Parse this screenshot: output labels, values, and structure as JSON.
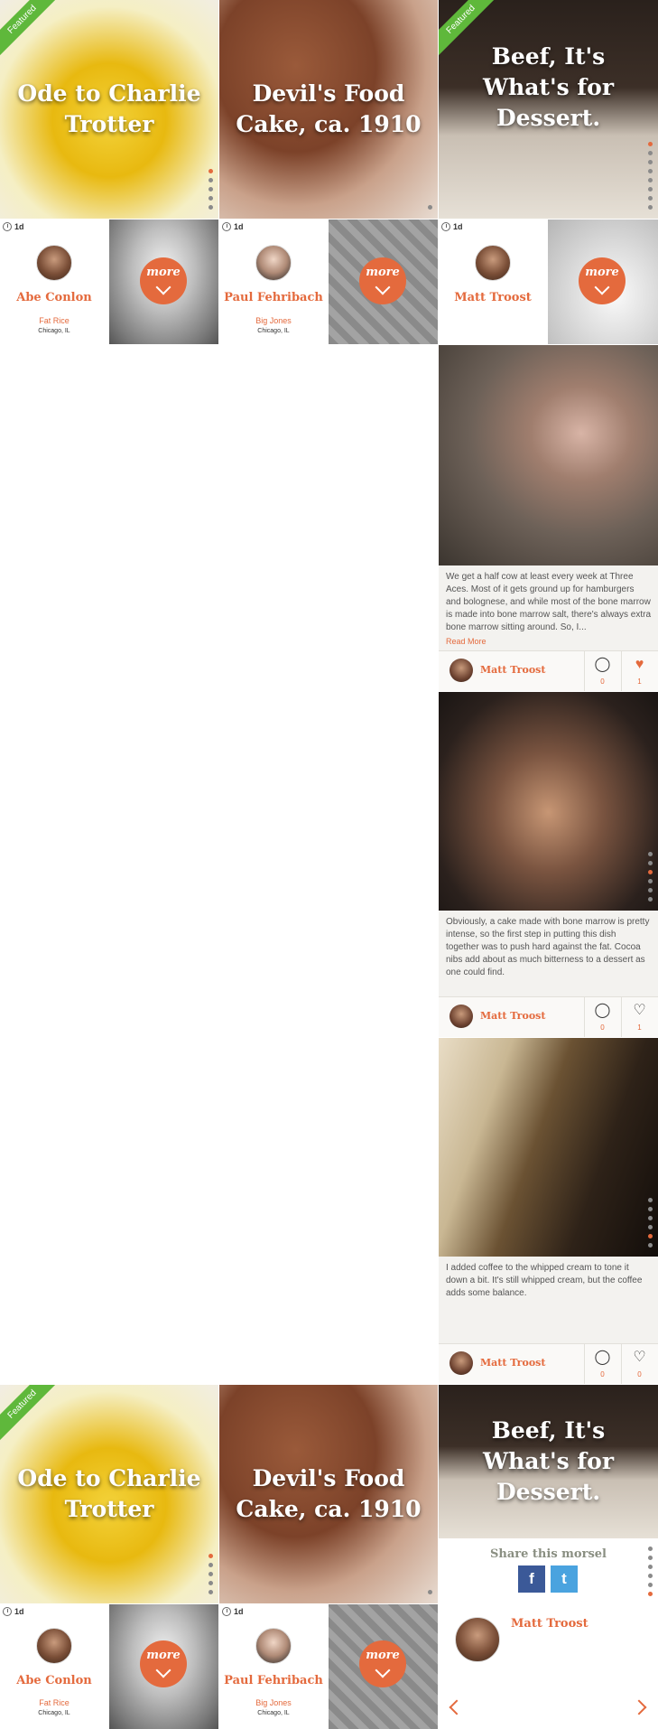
{
  "colors": {
    "accent": "#e46a3d",
    "featured": "#5fb83b",
    "facebook": "#3b5998",
    "twitter": "#4aa3df"
  },
  "featured_label": "Featured",
  "heroes": [
    {
      "title": "Ode to Charlie Trotter"
    },
    {
      "title": "Devil's Food Cake, ca. 1910"
    },
    {
      "title": "Beef, It's What's for Dessert."
    }
  ],
  "chefs": [
    {
      "time": "1d",
      "name": "Abe Conlon",
      "restaurant": "Fat Rice",
      "location": "Chicago, IL",
      "more_label": "more"
    },
    {
      "time": "1d",
      "name": "Paul Fehribach",
      "restaurant": "Big Jones",
      "location": "Chicago, IL",
      "more_label": "more"
    },
    {
      "time": "1d",
      "name": "Matt Troost",
      "restaurant": "",
      "location": "",
      "more_label": "more"
    }
  ],
  "posts": [
    {
      "text": "We get a half cow at least every week at Three Aces. Most of it gets ground up for hamburgers and bolognese, and while most of the bone marrow is made into bone marrow salt, there's always extra bone marrow sitting around. So, I...",
      "read_more": "Read More",
      "author": "Matt Troost",
      "comments": "0",
      "likes": "1"
    },
    {
      "text": "Obviously, a cake made with bone marrow is pretty intense, so the first step in putting this dish together was to push hard against the fat. Cocoa nibs add about as much bitterness to a dessert as one could find.",
      "author": "Matt Troost",
      "comments": "0",
      "likes": "1"
    },
    {
      "text": "I added coffee to the whipped cream to tone it down a bit. It's still whipped cream, but the coffee adds some balance.",
      "author": "Matt Troost",
      "comments": "0",
      "likes": "0"
    }
  ],
  "share": {
    "title": "Share this morsel",
    "facebook_glyph": "f",
    "twitter_glyph": "t"
  },
  "author_panel": {
    "name": "Matt Troost"
  }
}
